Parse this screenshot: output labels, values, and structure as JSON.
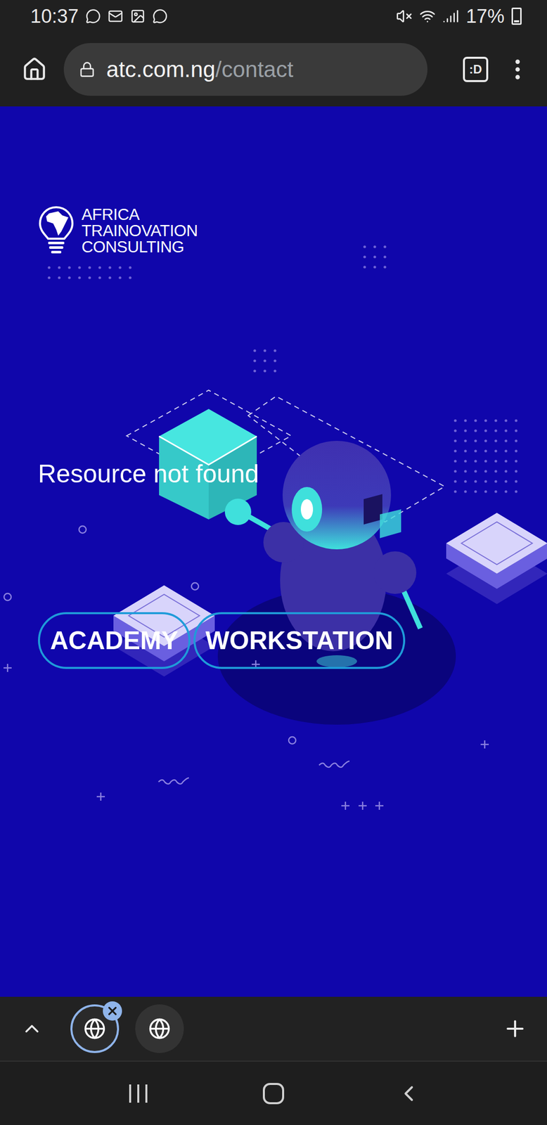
{
  "status_bar": {
    "time": "10:37",
    "battery": "17%",
    "battery_level": 0.17
  },
  "address_bar": {
    "host": "atc.com.ng",
    "path": "/contact",
    "secure": true,
    "tab_switcher": ":D"
  },
  "page": {
    "logo": {
      "lines": [
        "AFRICA",
        "TRAINOVATION",
        "CONSULTING"
      ]
    },
    "message": "Resource not found",
    "buttons": [
      "ACADEMY",
      "WORKSTATION"
    ]
  },
  "tabs": [
    {
      "selected": true,
      "closable": true
    },
    {
      "selected": false,
      "closable": false
    }
  ]
}
